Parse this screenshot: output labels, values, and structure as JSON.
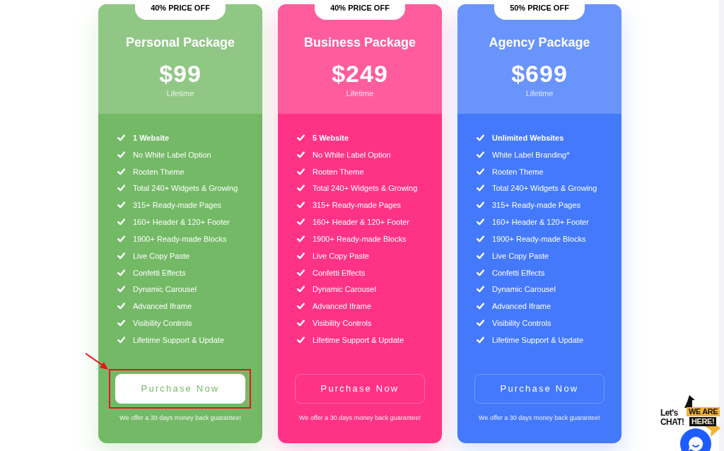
{
  "plans": [
    {
      "badge": "40% PRICE OFF",
      "name": "Personal Package",
      "price": "$99",
      "term": "Lifetime",
      "color": "#74b966",
      "features": [
        "1 Website",
        "No White Label Option",
        "Rooten Theme",
        "Total 240+ Widgets & Growing",
        "315+ Ready-made Pages",
        "160+ Header & 120+ Footer",
        "1900+ Ready-made Blocks",
        "Live Copy Paste",
        "Confetti Effects",
        "Dynamic Carousel",
        "Advanced Iframe",
        "Visibility Controls",
        "Lifetime Support & Update"
      ],
      "button": {
        "label": "Purchase Now",
        "filled": true,
        "annotated": true
      },
      "note": "We offer a 30 days money back guarantee!"
    },
    {
      "badge": "40% PRICE OFF",
      "name": "Business Package",
      "price": "$249",
      "term": "Lifetime",
      "color": "#ff3385",
      "features": [
        "5 Website",
        "No White Label Option",
        "Rooten Theme",
        "Total 240+ Widgets & Growing",
        "315+ Ready-made Pages",
        "160+ Header & 120+ Footer",
        "1900+ Ready-made Blocks",
        "Live Copy Paste",
        "Confetti Effects",
        "Dynamic Carousel",
        "Advanced Iframe",
        "Visibility Controls",
        "Lifetime Support & Update"
      ],
      "button": {
        "label": "Purchase Now",
        "filled": false,
        "annotated": false
      },
      "note": "We offer a 30 days money back guarantee!"
    },
    {
      "badge": "50% PRICE OFF",
      "name": "Agency Package",
      "price": "$699",
      "term": "Lifetime",
      "color": "#4479fb",
      "features": [
        "Unlimited Websites",
        "White Label Branding*",
        "Rooten Theme",
        "Total 240+ Widgets & Growing",
        "315+ Ready-made Pages",
        "160+ Header & 120+ Footer",
        "1900+ Ready-made Blocks",
        "Live Copy Paste",
        "Confetti Effects",
        "Dynamic Carousel",
        "Advanced Iframe",
        "Visibility Controls",
        "Lifetime Support & Update"
      ],
      "button": {
        "label": "Purchase Now",
        "filled": false,
        "annotated": false
      },
      "note": "We offer a 30 days money back guarantee!"
    }
  ],
  "chat_widget": {
    "caption": [
      "Let's",
      "CHAT!"
    ],
    "banner": [
      "WE ARE",
      "HERE!"
    ]
  }
}
